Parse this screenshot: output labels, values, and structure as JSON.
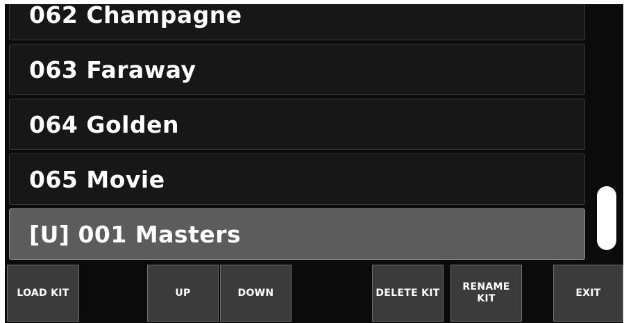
{
  "kit_list": {
    "items": [
      {
        "label": "062 Champagne",
        "selected": false
      },
      {
        "label": "063 Faraway",
        "selected": false
      },
      {
        "label": "064 Golden",
        "selected": false
      },
      {
        "label": "065 Movie",
        "selected": false
      },
      {
        "label": "[U] 001 Masters",
        "selected": true
      }
    ]
  },
  "toolbar": {
    "load_kit": "LOAD KIT",
    "up": "UP",
    "down": "DOWN",
    "delete_kit": "DELETE KIT",
    "rename_kit_line1": "RENAME",
    "rename_kit_line2": "KIT",
    "exit": "EXIT"
  },
  "colors": {
    "background": "#0b0b0b",
    "row": "#171717",
    "row_selected": "#5c5c5c",
    "button": "#3b3b3b",
    "text": "#ffffff"
  }
}
